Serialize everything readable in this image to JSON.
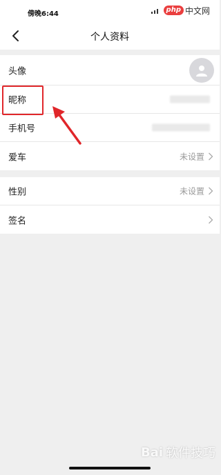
{
  "status_bar": {
    "time": "傍晚6:44",
    "php_logo": "php",
    "php_site": "中文网"
  },
  "nav": {
    "title": "个人资料",
    "back_icon": "chevron-left-icon"
  },
  "profile_rows": [
    {
      "label": "头像",
      "value": "",
      "icon": "avatar-placeholder"
    },
    {
      "label": "昵称",
      "value": ""
    },
    {
      "label": "手机号",
      "value": ""
    },
    {
      "label": "爱车",
      "value": "未设置"
    }
  ],
  "extra_rows": [
    {
      "label": "性别",
      "value": "未设置"
    },
    {
      "label": "签名",
      "value": ""
    }
  ],
  "annotation": {
    "color": "#e0262a",
    "target": "昵称"
  },
  "watermark": {
    "logo": "Bai",
    "text": "软件技巧"
  },
  "colors": {
    "background": "#efefef",
    "card": "#ffffff",
    "value_text": "#999999",
    "annotation_red": "#e0262a"
  }
}
